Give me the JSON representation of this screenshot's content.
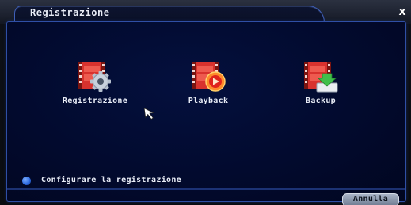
{
  "window": {
    "title": "Registrazione",
    "close_label": "x"
  },
  "menu": {
    "items": [
      {
        "label": "Registrazione",
        "icon": "film-gear-icon"
      },
      {
        "label": "Playback",
        "icon": "film-play-icon"
      },
      {
        "label": "Backup",
        "icon": "film-download-icon"
      }
    ]
  },
  "hint": {
    "text": "Configurare la registrazione"
  },
  "footer": {
    "cancel_label": "Annulla"
  },
  "colors": {
    "panel_background": "#020a2e",
    "panel_border": "#2f4fa6",
    "text": "#e8ecf6",
    "film_red": "#d8322e",
    "accent_green": "#3fbf4a"
  }
}
